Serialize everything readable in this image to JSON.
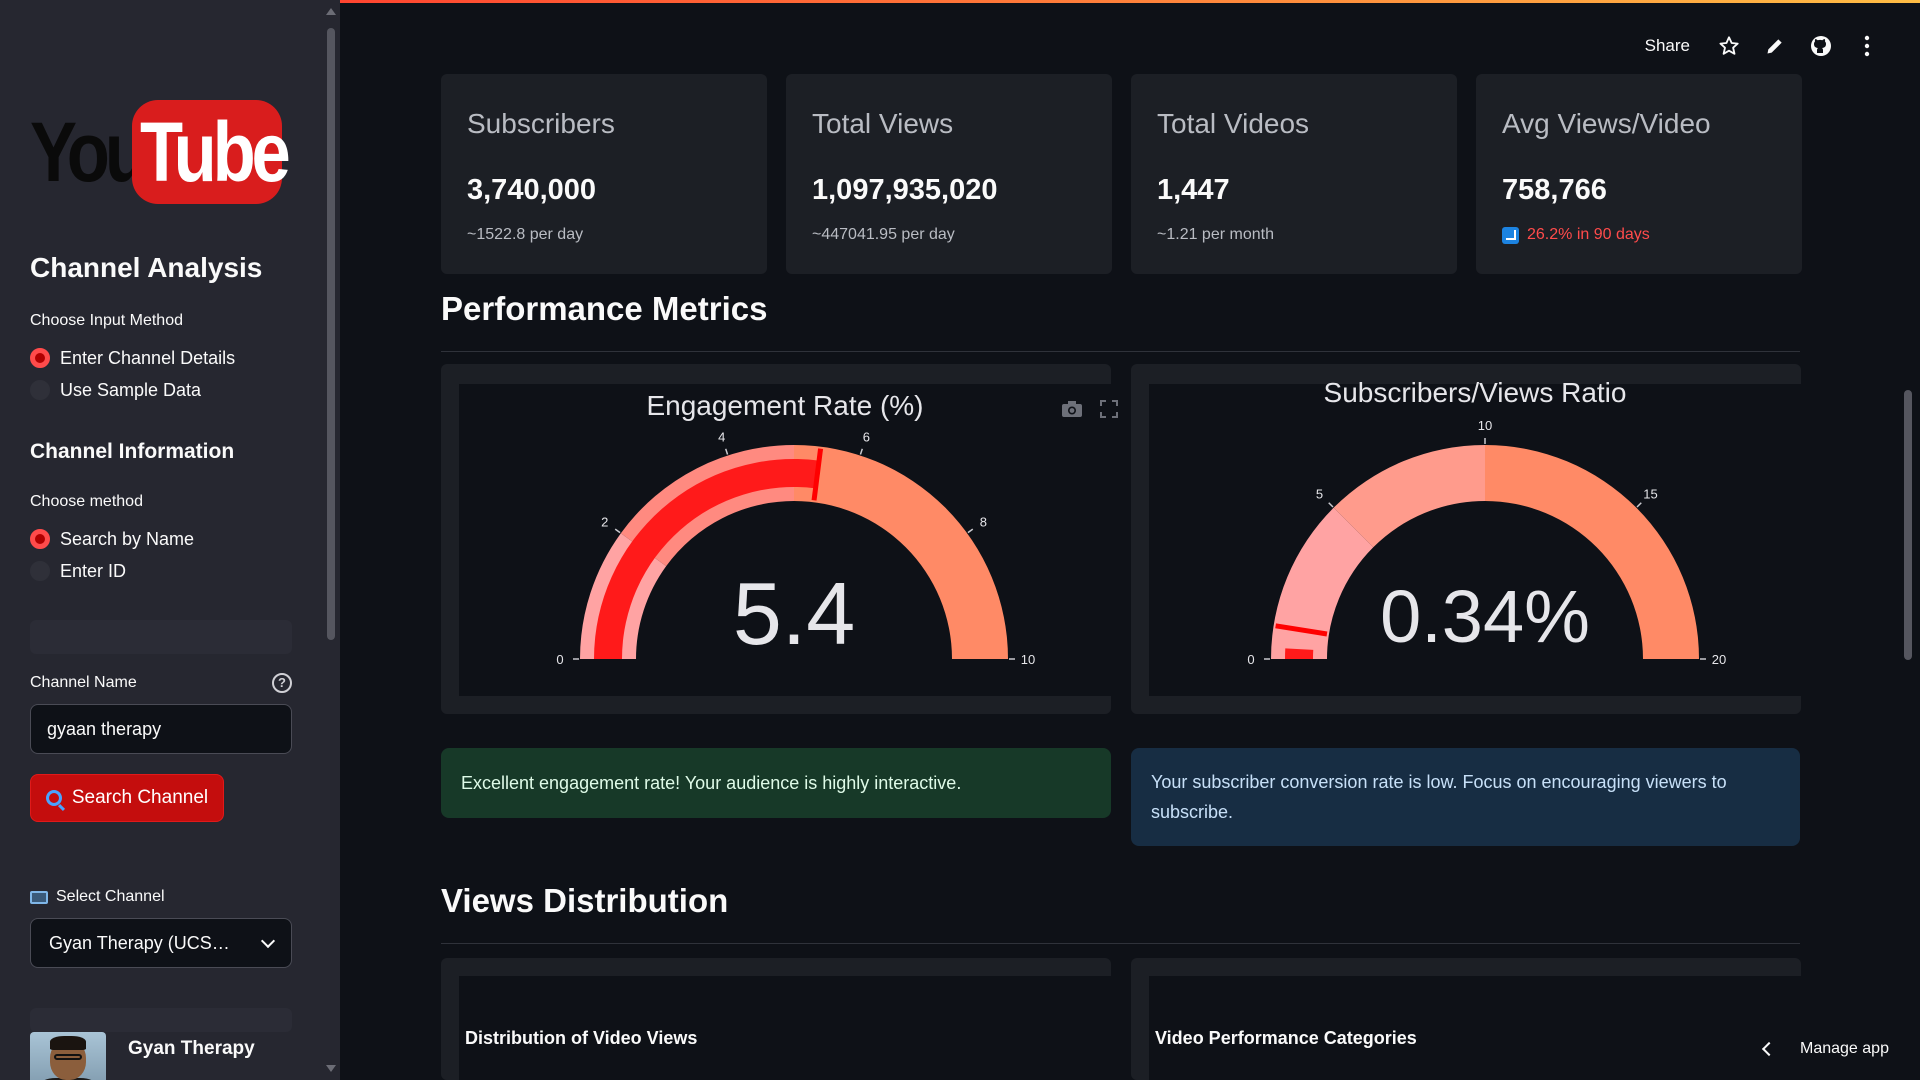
{
  "sidebar": {
    "logo": {
      "you": "You",
      "tube": "Tube"
    },
    "title": "Channel Analysis",
    "input_method": {
      "label": "Choose Input Method",
      "options": [
        "Enter Channel Details",
        "Use Sample Data"
      ],
      "selected": "Enter Channel Details"
    },
    "channel_info_title": "Channel Information",
    "method": {
      "label": "Choose method",
      "options": [
        "Search by Name",
        "Enter ID"
      ],
      "selected": "Search by Name"
    },
    "channel_name": {
      "label": "Channel Name",
      "value": "gyaan therapy"
    },
    "search_button": "Search Channel",
    "select_channel": {
      "label": "Select Channel",
      "value": "Gyan Therapy (UCS…"
    },
    "channel_card": {
      "name": "Gyan Therapy"
    }
  },
  "header": {
    "share_label": "Share"
  },
  "metrics": [
    {
      "label": "Subscribers",
      "value": "3,740,000",
      "delta": "~1522.8 per day"
    },
    {
      "label": "Total Views",
      "value": "1,097,935,020",
      "delta": "~447041.95 per day"
    },
    {
      "label": "Total Videos",
      "value": "1,447",
      "delta": "~1.21 per month"
    },
    {
      "label": "Avg Views/Video",
      "value": "758,766",
      "delta": "26.2% in 90 days",
      "delta_color": "#ff4b4b"
    }
  ],
  "performance": {
    "title": "Performance Metrics",
    "gauges": [
      {
        "title": "Engagement Rate (%)",
        "value": 5.4,
        "display": "5.4",
        "range": [
          0,
          10
        ],
        "ticks": [
          "0",
          "2",
          "4",
          "6",
          "8",
          "10"
        ],
        "steps": [
          {
            "from": 0,
            "to": 2,
            "color": "#ffa3a3"
          },
          {
            "from": 2,
            "to": 5,
            "color": "#ff8a80"
          },
          {
            "from": 5,
            "to": 10,
            "color": "#ff8a66"
          }
        ],
        "bar_color": "#ff1a1a",
        "threshold": 5.4
      },
      {
        "title": "Subscribers/Views Ratio",
        "value": 0.34,
        "display": "0.34%",
        "range": [
          0,
          20
        ],
        "ticks": [
          "0",
          "5",
          "10",
          "15",
          "20"
        ],
        "steps": [
          {
            "from": 0,
            "to": 5,
            "color": "#ffa3a3"
          },
          {
            "from": 5,
            "to": 10,
            "color": "#ff9b8c"
          },
          {
            "from": 10,
            "to": 20,
            "color": "#ff8a66"
          }
        ],
        "bar_color": "#ff1a1a",
        "threshold": 1
      }
    ],
    "alerts": [
      "Excellent engagement rate! Your audience is highly interactive.",
      "Your subscriber conversion rate is low. Focus on encouraging viewers to subscribe."
    ]
  },
  "views_distribution": {
    "title": "Views Distribution",
    "charts": [
      "Distribution of Video Views",
      "Video Performance Categories"
    ]
  },
  "footer": {
    "manage_app": "Manage app"
  },
  "colors": {
    "accent": "#ff4b4b",
    "sidebar_bg": "#262730",
    "main_bg": "#0e1117",
    "card_bg": "#1c1f25",
    "youtube_red": "#d91d1d"
  }
}
